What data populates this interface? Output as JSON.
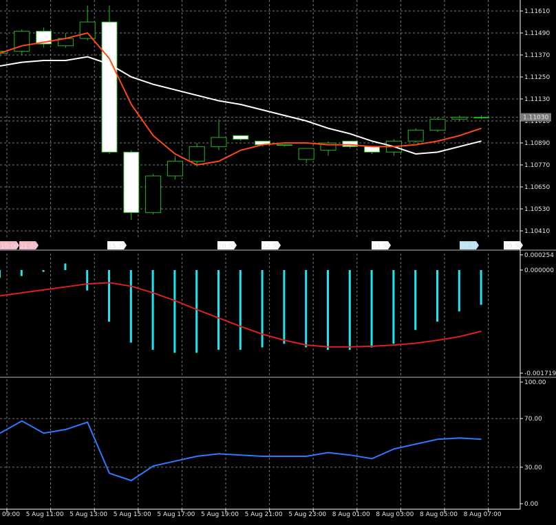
{
  "colors": {
    "background": "#000000",
    "grid": "#7a7a7a",
    "axis": "#ffffff",
    "text": "#e6e6e6",
    "candle_up_border": "#1fb91f",
    "candle_body": "#ffffff",
    "ma_fast": "#ff4b12",
    "ma_slow": "#ffffff",
    "histogram": "#1ee7f3",
    "signal": "#e0201a",
    "rsi": "#2b7cff",
    "price_marker_bg": "#7b7b7b",
    "time_marker_pink": "#f5b8c5",
    "time_marker_light": "#b8e4f5",
    "time_marker_white": "#ffffff"
  },
  "time_markers": [
    {
      "label": "10:00",
      "style": "pink"
    },
    {
      "label": "11:00",
      "style": "pink"
    },
    {
      "label": "15:30",
      "style": "white"
    },
    {
      "label": "20:00",
      "style": "white"
    },
    {
      "label": "22:00",
      "style": "white"
    },
    {
      "label": "03:00",
      "style": "white"
    },
    {
      "label": "07:30",
      "style": "light"
    },
    {
      "label": "09:00",
      "style": "white"
    }
  ],
  "current_price_label": "1.11030",
  "chart_data": [
    {
      "type": "candlestick",
      "panel": "price",
      "y_ticks": [
        "1.11610",
        "1.11490",
        "1.11370",
        "1.11250",
        "1.11130",
        "1.11010",
        "1.10890",
        "1.10770",
        "1.10650",
        "1.10530",
        "1.10410"
      ],
      "ylim": [
        1.1038,
        1.1166
      ],
      "candles": [
        {
          "o": 1.1138,
          "h": 1.1139,
          "l": 1.1136,
          "c": 1.1139
        },
        {
          "o": 1.1139,
          "h": 1.1151,
          "l": 1.1137,
          "c": 1.115
        },
        {
          "o": 1.115,
          "h": 1.1152,
          "l": 1.1141,
          "c": 1.1143
        },
        {
          "o": 1.1142,
          "h": 1.1149,
          "l": 1.1141,
          "c": 1.1146
        },
        {
          "o": 1.1146,
          "h": 1.1164,
          "l": 1.1145,
          "c": 1.1155
        },
        {
          "o": 1.1155,
          "h": 1.1164,
          "l": 1.1083,
          "c": 1.1084
        },
        {
          "o": 1.1084,
          "h": 1.1085,
          "l": 1.1047,
          "c": 1.1051
        },
        {
          "o": 1.1051,
          "h": 1.1072,
          "l": 1.105,
          "c": 1.1071
        },
        {
          "o": 1.1071,
          "h": 1.1082,
          "l": 1.1069,
          "c": 1.1079
        },
        {
          "o": 1.1079,
          "h": 1.1089,
          "l": 1.1076,
          "c": 1.1087
        },
        {
          "o": 1.1087,
          "h": 1.1102,
          "l": 1.1085,
          "c": 1.1092
        },
        {
          "o": 1.1093,
          "h": 1.1093,
          "l": 1.109,
          "c": 1.1091
        },
        {
          "o": 1.109,
          "h": 1.109,
          "l": 1.1087,
          "c": 1.1088
        },
        {
          "o": 1.1088,
          "h": 1.1088,
          "l": 1.1087,
          "c": 1.1088
        },
        {
          "o": 1.108,
          "h": 1.1086,
          "l": 1.1078,
          "c": 1.1086
        },
        {
          "o": 1.1085,
          "h": 1.109,
          "l": 1.1082,
          "c": 1.1089
        },
        {
          "o": 1.109,
          "h": 1.109,
          "l": 1.1086,
          "c": 1.1087
        },
        {
          "o": 1.1087,
          "h": 1.1087,
          "l": 1.1083,
          "c": 1.1084
        },
        {
          "o": 1.1084,
          "h": 1.1091,
          "l": 1.1082,
          "c": 1.109
        },
        {
          "o": 1.109,
          "h": 1.1097,
          "l": 1.1089,
          "c": 1.1096
        },
        {
          "o": 1.1096,
          "h": 1.1103,
          "l": 1.1095,
          "c": 1.1102
        },
        {
          "o": 1.1102,
          "h": 1.1104,
          "l": 1.1101,
          "c": 1.1103
        },
        {
          "o": 1.1103,
          "h": 1.1104,
          "l": 1.1102,
          "c": 1.1103
        }
      ],
      "ma_fast": [
        1.1138,
        1.1142,
        1.1144,
        1.1146,
        1.1149,
        1.1135,
        1.111,
        1.1093,
        1.1083,
        1.1077,
        1.1079,
        1.1085,
        1.1088,
        1.1089,
        1.1089,
        1.1088,
        1.1088,
        1.1087,
        1.1087,
        1.1088,
        1.109,
        1.1093,
        1.1097
      ],
      "ma_slow": [
        1.1131,
        1.1133,
        1.1134,
        1.1134,
        1.1136,
        1.1132,
        1.1125,
        1.1121,
        1.1118,
        1.1115,
        1.1112,
        1.111,
        1.1107,
        1.1104,
        1.1101,
        1.1097,
        1.1094,
        1.109,
        1.1087,
        1.1083,
        1.1084,
        1.1087,
        1.109
      ]
    },
    {
      "type": "bar",
      "panel": "macd",
      "y_ticks": [
        "0.000254",
        "0.000000",
        "-0.001719"
      ],
      "ylim": [
        -0.001719,
        0.000254
      ],
      "histogram": [
        -0.00013,
        -0.0001,
        -3e-05,
        0.00011,
        -0.00034,
        -0.00086,
        -0.00121,
        -0.00133,
        -0.00138,
        -0.00138,
        -0.00133,
        -0.00133,
        -0.00129,
        -0.00123,
        -0.00129,
        -0.00133,
        -0.00133,
        -0.00129,
        -0.00123,
        -0.001,
        -0.00086,
        -0.00069,
        -0.00058
      ],
      "signal": [
        -0.00043,
        -0.00038,
        -0.00033,
        -0.00028,
        -0.00023,
        -0.00021,
        -0.00027,
        -0.00038,
        -0.00051,
        -0.00066,
        -0.0008,
        -0.00094,
        -0.00107,
        -0.00117,
        -0.00125,
        -0.00128,
        -0.00128,
        -0.00127,
        -0.00125,
        -0.00122,
        -0.00117,
        -0.00111,
        -0.00102
      ]
    },
    {
      "type": "line",
      "panel": "rsi",
      "y_ticks": [
        "100.00",
        "70.00",
        "30.00",
        "0.00"
      ],
      "ylim": [
        0,
        100
      ],
      "x_tick_labels": [
        "5 Aug 09:00",
        "5 Aug 11:00",
        "5 Aug 13:00",
        "5 Aug 15:00",
        "5 Aug 17:00",
        "5 Aug 19:00",
        "5 Aug 21:00",
        "5 Aug 23:00",
        "8 Aug 01:00",
        "8 Aug 03:00",
        "8 Aug 05:00",
        "8 Aug 07:00"
      ],
      "values": [
        58,
        68,
        58,
        61,
        67,
        25,
        19,
        31,
        35,
        39,
        41,
        40,
        39,
        39,
        39,
        42,
        40,
        37,
        45,
        49,
        53,
        54,
        53
      ]
    }
  ]
}
